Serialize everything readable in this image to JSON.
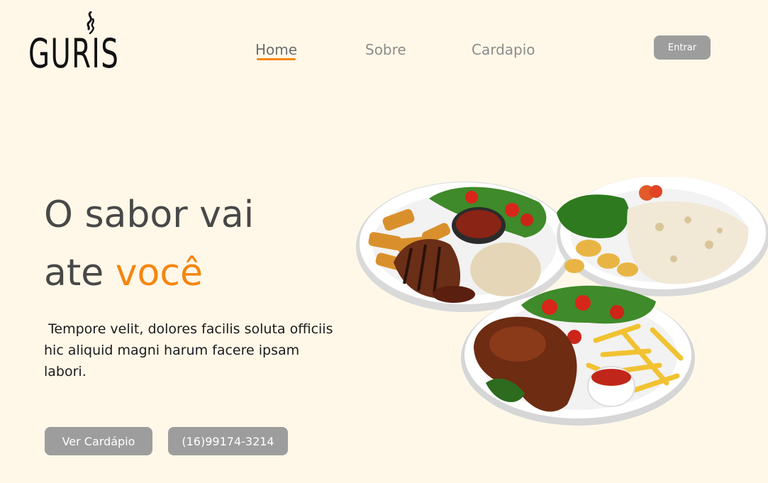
{
  "brand": {
    "name": "GURIS",
    "logo_icon": "flame-icon"
  },
  "nav": {
    "items": [
      {
        "label": "Home",
        "active": true
      },
      {
        "label": "Sobre",
        "active": false
      },
      {
        "label": "Cardapio",
        "active": false
      }
    ],
    "login_label": "Entrar"
  },
  "hero": {
    "title_line1": "O sabor vai",
    "title_line2_prefix": "ate ",
    "title_line2_accent": "você",
    "description": " Tempore velit, dolores facilis soluta officiis\nhic aliquid magni harum facere ipsam\nlabori.",
    "cta_menu_label": "Ver Cardápio",
    "cta_phone_label": "(16)99174-3214",
    "image_icon": "food-plates-image"
  },
  "colors": {
    "background": "#fff8e9",
    "accent": "#f5860f",
    "button": "#9d9d9d",
    "text_dark": "#484848"
  }
}
